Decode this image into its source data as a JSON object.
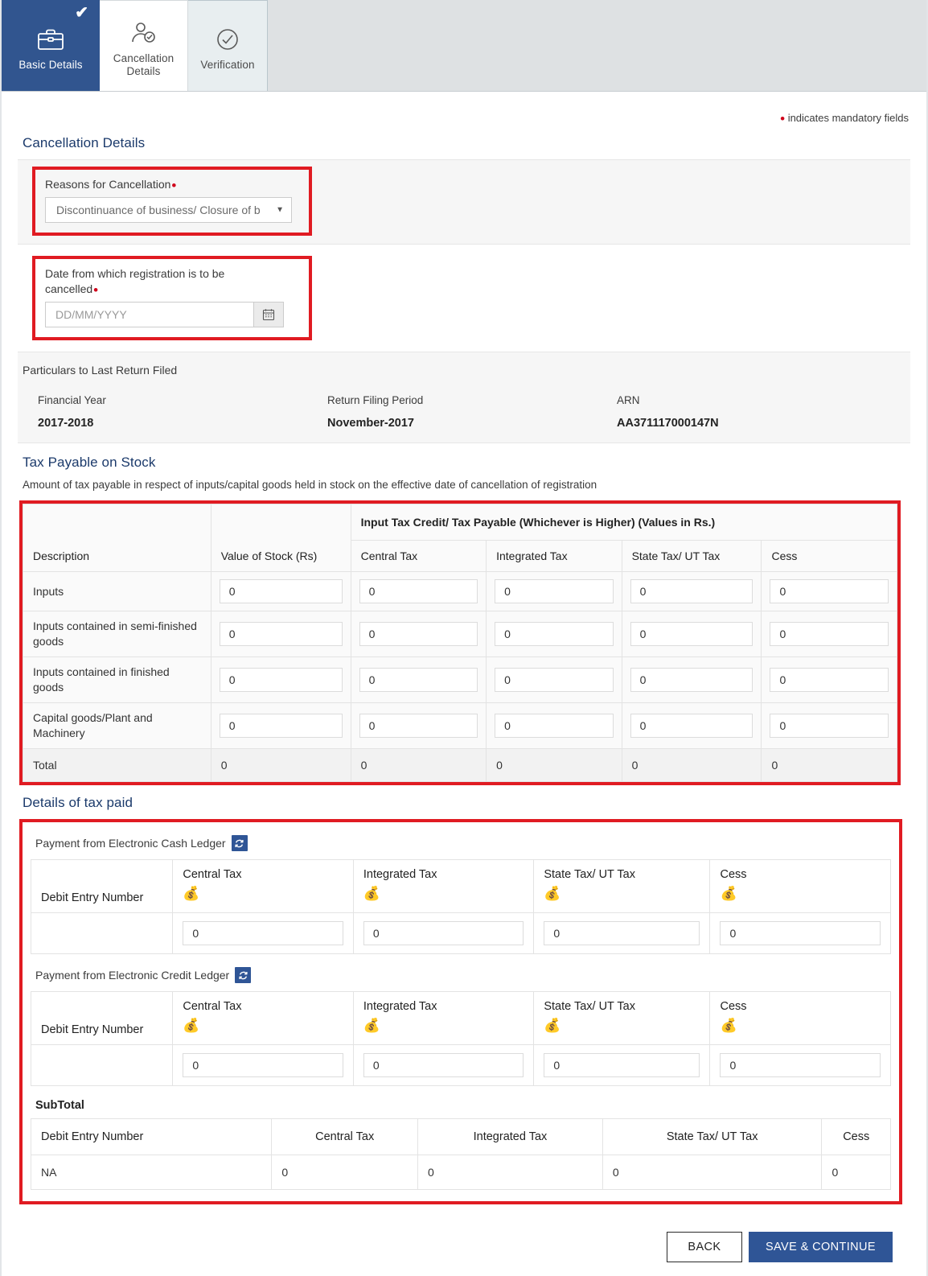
{
  "stepper": {
    "steps": [
      {
        "label": "Basic Details",
        "icon": "briefcase-icon",
        "state": "completed"
      },
      {
        "label": "Cancellation Details",
        "icon": "user-check-icon",
        "state": "current"
      },
      {
        "label": "Verification",
        "icon": "check-circle-icon",
        "state": "pending"
      }
    ]
  },
  "mandatory_note": "indicates mandatory fields",
  "cancellation": {
    "title": "Cancellation Details",
    "reason_label": "Reasons for Cancellation",
    "reason_value": "Discontinuance of business/ Closure of b",
    "date_label": "Date from which registration is to be cancelled",
    "date_value": "",
    "date_placeholder": "DD/MM/YYYY",
    "calendar_icon": "calendar-icon"
  },
  "particulars": {
    "title": "Particulars to Last Return Filed",
    "fields": [
      {
        "label": "Financial Year",
        "value": "2017-2018"
      },
      {
        "label": "Return Filing Period",
        "value": "November-2017"
      },
      {
        "label": "ARN",
        "value": "AA371117000147N"
      }
    ]
  },
  "stock": {
    "title": "Tax Payable on Stock",
    "note": "Amount of tax payable in respect of inputs/capital goods held in stock on the effective date of cancellation of registration",
    "col_description": "Description",
    "col_value_of_stock": "Value of Stock (Rs)",
    "group_header": "Input Tax Credit/ Tax Payable (Whichever is Higher) (Values in Rs.)",
    "tax_columns": [
      "Central Tax",
      "Integrated Tax",
      "State Tax/ UT Tax",
      "Cess"
    ],
    "rows": [
      {
        "description": "Inputs",
        "value_of_stock": "0",
        "central": "0",
        "integrated": "0",
        "state": "0",
        "cess": "0"
      },
      {
        "description": "Inputs contained in semi-finished goods",
        "value_of_stock": "0",
        "central": "0",
        "integrated": "0",
        "state": "0",
        "cess": "0"
      },
      {
        "description": "Inputs contained in finished goods",
        "value_of_stock": "0",
        "central": "0",
        "integrated": "0",
        "state": "0",
        "cess": "0"
      },
      {
        "description": "Capital goods/Plant and Machinery",
        "value_of_stock": "0",
        "central": "0",
        "integrated": "0",
        "state": "0",
        "cess": "0"
      }
    ],
    "total": {
      "label": "Total",
      "value_of_stock": "0",
      "central": "0",
      "integrated": "0",
      "state": "0",
      "cess": "0"
    }
  },
  "tax_paid": {
    "title": "Details of tax paid",
    "cash_ledger": {
      "label": "Payment from Electronic Cash Ledger",
      "refresh_icon": "refresh-icon",
      "col_debit_entry": "Debit Entry Number",
      "columns": [
        "Central Tax",
        "Integrated Tax",
        "State Tax/ UT Tax",
        "Cess"
      ],
      "money_icon": "money-bag-icon",
      "row": {
        "debit_entry": "",
        "central": "0",
        "integrated": "0",
        "state": "0",
        "cess": "0"
      }
    },
    "credit_ledger": {
      "label": "Payment from Electronic Credit Ledger",
      "refresh_icon": "refresh-icon",
      "col_debit_entry": "Debit Entry Number",
      "columns": [
        "Central Tax",
        "Integrated Tax",
        "State Tax/ UT Tax",
        "Cess"
      ],
      "money_icon": "money-bag-icon",
      "row": {
        "debit_entry": "",
        "central": "0",
        "integrated": "0",
        "state": "0",
        "cess": "0"
      }
    },
    "subtotal": {
      "label": "SubTotal",
      "col_debit_entry": "Debit Entry Number",
      "columns": [
        "Central Tax",
        "Integrated Tax",
        "State Tax/ UT Tax",
        "Cess"
      ],
      "row": {
        "debit_entry": "NA",
        "central": "0",
        "integrated": "0",
        "state": "0",
        "cess": "0"
      }
    }
  },
  "footer": {
    "back_label": "BACK",
    "save_label": "SAVE & CONTINUE"
  },
  "colors": {
    "accent_blue": "#2f5596",
    "active_tab": "#31558f",
    "required_red": "#d0021b",
    "highlight_red": "#e01b22"
  }
}
